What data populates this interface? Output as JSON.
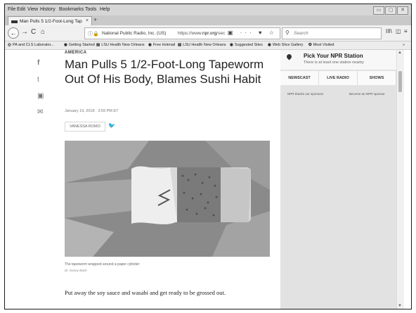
{
  "menu": [
    "File",
    "Edit",
    "View",
    "History",
    "Bookmarks",
    "Tools",
    "Help"
  ],
  "tab": {
    "title": "Man Pulls 5 1/2-Foot-Long Tap",
    "close": "×",
    "new": "+"
  },
  "nav": {
    "back": "←",
    "forward": "→",
    "reload": "C",
    "home": "⌂",
    "site_identity": "National Public Radio, Inc. (US)",
    "url_prefix": "https://www.",
    "url_domain": "npr.org",
    "url_rest": "/sec",
    "url_icons": "▣ ··· ♥ ☆",
    "search_placeholder": "Search",
    "library": "III\\",
    "sidebar_toggle": "◫",
    "menu": "≡"
  },
  "bookmarks": [
    {
      "label": "PA and CLS Laborator...",
      "icon": "◎"
    },
    {
      "label": "Getting Started",
      "icon": "◉"
    },
    {
      "label": "LSU Health New Orleans",
      "icon": "▤"
    },
    {
      "label": "Free Hotmail",
      "icon": "◉"
    },
    {
      "label": "LSU Health New Orleans",
      "icon": "▤"
    },
    {
      "label": "Suggested Sites",
      "icon": "◉"
    },
    {
      "label": "Web Slice Gallery",
      "icon": "◉"
    },
    {
      "label": "Most Visited",
      "icon": "✪"
    }
  ],
  "bookmarks_overflow": "»",
  "article": {
    "section": "AMERICA",
    "headline": "Man Pulls 5 1/2-Foot-Long Tapeworm Out Of His Body, Blames Sushi Habit",
    "date": "January 19, 2018 · 3:59 PM ET",
    "author": "VANESSA ROMO",
    "caption": "The tapeworm wrapped around a paper cylinder",
    "credit": "Dr. Kenny Banh",
    "body": "Put away the soy sauce and wasabi and get ready to be grossed out."
  },
  "sidebar": {
    "station_title": "Pick Your NPR Station",
    "station_sub": "There is at least one station nearby",
    "buttons": [
      "NEWSCAST",
      "LIVE RADIO",
      "SHOWS"
    ],
    "sponsor_left": "NPR thanks our sponsors",
    "sponsor_right": "Become an NPR sponsor"
  },
  "share_icons": [
    "f",
    "t",
    "▣",
    "✉"
  ],
  "window_buttons": [
    "▭",
    "▢",
    "✕"
  ],
  "scroll": {
    "up": "▲",
    "down": "▼"
  }
}
